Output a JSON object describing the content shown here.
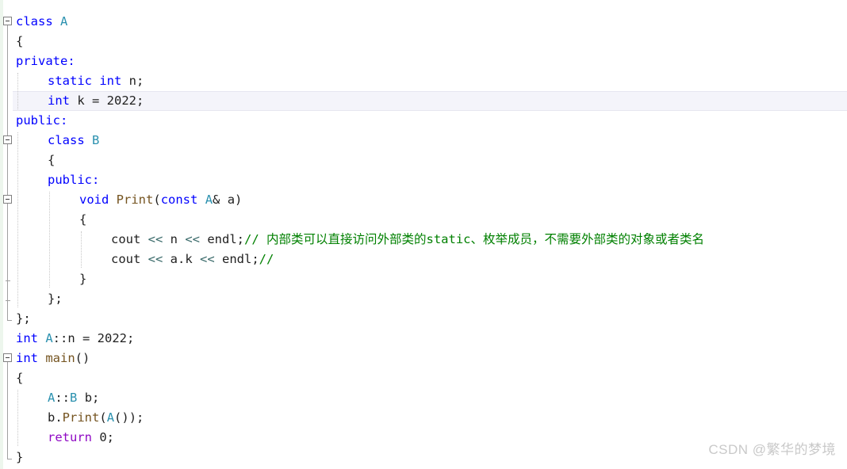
{
  "editor": {
    "language": "cpp",
    "background_color": "#ffffff",
    "change_bar_color": "#edf6ed",
    "current_line_highlight_color": "#f4f4fa",
    "current_line_index": 5,
    "colors": {
      "keyword": "#0000ff",
      "user_type": "#2b91af",
      "function": "#74531f",
      "control_keyword": "#8f08c4",
      "comment": "#008000",
      "plain_text": "#1f1f1f",
      "operator": "#3a6a6a",
      "fold_marker": "#808080",
      "indent_guide": "#c8c8c8",
      "watermark": "#c9c9c9"
    },
    "lines": [
      {
        "id": "line-partial-top",
        "indent": 0,
        "tokens": []
      },
      {
        "id": "line-class-a",
        "indent": 0,
        "tokens": [
          {
            "text": "class ",
            "kind": "kw"
          },
          {
            "text": "A",
            "kind": "type"
          }
        ]
      },
      {
        "id": "line-open-brace-a",
        "indent": 0,
        "tokens": [
          {
            "text": "{",
            "kind": "plain"
          }
        ]
      },
      {
        "id": "line-private",
        "indent": 0,
        "tokens": [
          {
            "text": "private:",
            "kind": "kw"
          }
        ]
      },
      {
        "id": "line-static-int-n",
        "indent": 1,
        "tokens": [
          {
            "text": "static int ",
            "kind": "kw"
          },
          {
            "text": "n;",
            "kind": "plain"
          }
        ]
      },
      {
        "id": "line-int-k",
        "indent": 1,
        "tokens": [
          {
            "text": "int ",
            "kind": "kw"
          },
          {
            "text": "k = 2022;",
            "kind": "plain"
          }
        ]
      },
      {
        "id": "line-public-a",
        "indent": 0,
        "tokens": [
          {
            "text": "public:",
            "kind": "kw"
          }
        ]
      },
      {
        "id": "line-class-b",
        "indent": 1,
        "tokens": [
          {
            "text": "class ",
            "kind": "kw"
          },
          {
            "text": "B",
            "kind": "type"
          }
        ]
      },
      {
        "id": "line-open-brace-b",
        "indent": 1,
        "tokens": [
          {
            "text": "{",
            "kind": "plain"
          }
        ]
      },
      {
        "id": "line-public-b",
        "indent": 1,
        "tokens": [
          {
            "text": "public:",
            "kind": "kw"
          }
        ]
      },
      {
        "id": "line-print-signature",
        "indent": 2,
        "tokens": [
          {
            "text": "void ",
            "kind": "kw"
          },
          {
            "text": "Print",
            "kind": "fn"
          },
          {
            "text": "(",
            "kind": "plain"
          },
          {
            "text": "const ",
            "kind": "kw"
          },
          {
            "text": "A",
            "kind": "type"
          },
          {
            "text": "& a)",
            "kind": "plain"
          }
        ]
      },
      {
        "id": "line-open-brace-print",
        "indent": 2,
        "tokens": [
          {
            "text": "{",
            "kind": "plain"
          }
        ]
      },
      {
        "id": "line-cout-n",
        "indent": 3,
        "tokens": [
          {
            "text": "cout ",
            "kind": "plain"
          },
          {
            "text": "<< ",
            "kind": "op"
          },
          {
            "text": "n ",
            "kind": "plain"
          },
          {
            "text": "<< ",
            "kind": "op"
          },
          {
            "text": "endl;",
            "kind": "plain"
          },
          {
            "text": "// 内部类可以直接访问外部类的static、枚举成员，不需要外部类的对象或者类名",
            "kind": "cmt"
          }
        ]
      },
      {
        "id": "line-cout-ak",
        "indent": 3,
        "tokens": [
          {
            "text": "cout ",
            "kind": "plain"
          },
          {
            "text": "<< ",
            "kind": "op"
          },
          {
            "text": "a.k ",
            "kind": "plain"
          },
          {
            "text": "<< ",
            "kind": "op"
          },
          {
            "text": "endl;",
            "kind": "plain"
          },
          {
            "text": "//",
            "kind": "cmt"
          }
        ]
      },
      {
        "id": "line-close-brace-print",
        "indent": 2,
        "tokens": [
          {
            "text": "}",
            "kind": "plain"
          }
        ]
      },
      {
        "id": "line-close-brace-b",
        "indent": 1,
        "tokens": [
          {
            "text": "};",
            "kind": "plain"
          }
        ]
      },
      {
        "id": "line-close-brace-a",
        "indent": 0,
        "tokens": [
          {
            "text": "};",
            "kind": "plain"
          }
        ]
      },
      {
        "id": "line-static-def",
        "indent": 0,
        "tokens": [
          {
            "text": "int ",
            "kind": "kw"
          },
          {
            "text": "A",
            "kind": "type"
          },
          {
            "text": "::n = 2022;",
            "kind": "plain"
          }
        ]
      },
      {
        "id": "line-main-signature",
        "indent": 0,
        "tokens": [
          {
            "text": "int ",
            "kind": "kw"
          },
          {
            "text": "main",
            "kind": "fn"
          },
          {
            "text": "()",
            "kind": "plain"
          }
        ]
      },
      {
        "id": "line-open-brace-main",
        "indent": 0,
        "tokens": [
          {
            "text": "{",
            "kind": "plain"
          }
        ]
      },
      {
        "id": "line-decl-b",
        "indent": 1,
        "tokens": [
          {
            "text": "A",
            "kind": "type"
          },
          {
            "text": "::",
            "kind": "plain"
          },
          {
            "text": "B",
            "kind": "type"
          },
          {
            "text": " b;",
            "kind": "plain"
          }
        ]
      },
      {
        "id": "line-call-print",
        "indent": 1,
        "tokens": [
          {
            "text": "b.",
            "kind": "plain"
          },
          {
            "text": "Print",
            "kind": "fn"
          },
          {
            "text": "(",
            "kind": "plain"
          },
          {
            "text": "A",
            "kind": "type"
          },
          {
            "text": "());",
            "kind": "plain"
          }
        ]
      },
      {
        "id": "line-return",
        "indent": 1,
        "tokens": [
          {
            "text": "return ",
            "kind": "ctl"
          },
          {
            "text": "0;",
            "kind": "plain"
          }
        ]
      },
      {
        "id": "line-close-brace-main",
        "indent": 0,
        "tokens": [
          {
            "text": "}",
            "kind": "plain"
          }
        ]
      }
    ],
    "fold_markers": [
      {
        "name": "fold-marker-class-a",
        "line": 1,
        "state": "expanded"
      },
      {
        "name": "fold-marker-class-b",
        "line": 7,
        "state": "expanded"
      },
      {
        "name": "fold-marker-print",
        "line": 10,
        "state": "expanded"
      },
      {
        "name": "fold-marker-main",
        "line": 18,
        "state": "expanded"
      }
    ]
  },
  "watermark": {
    "text": "CSDN @繁华的梦境"
  }
}
